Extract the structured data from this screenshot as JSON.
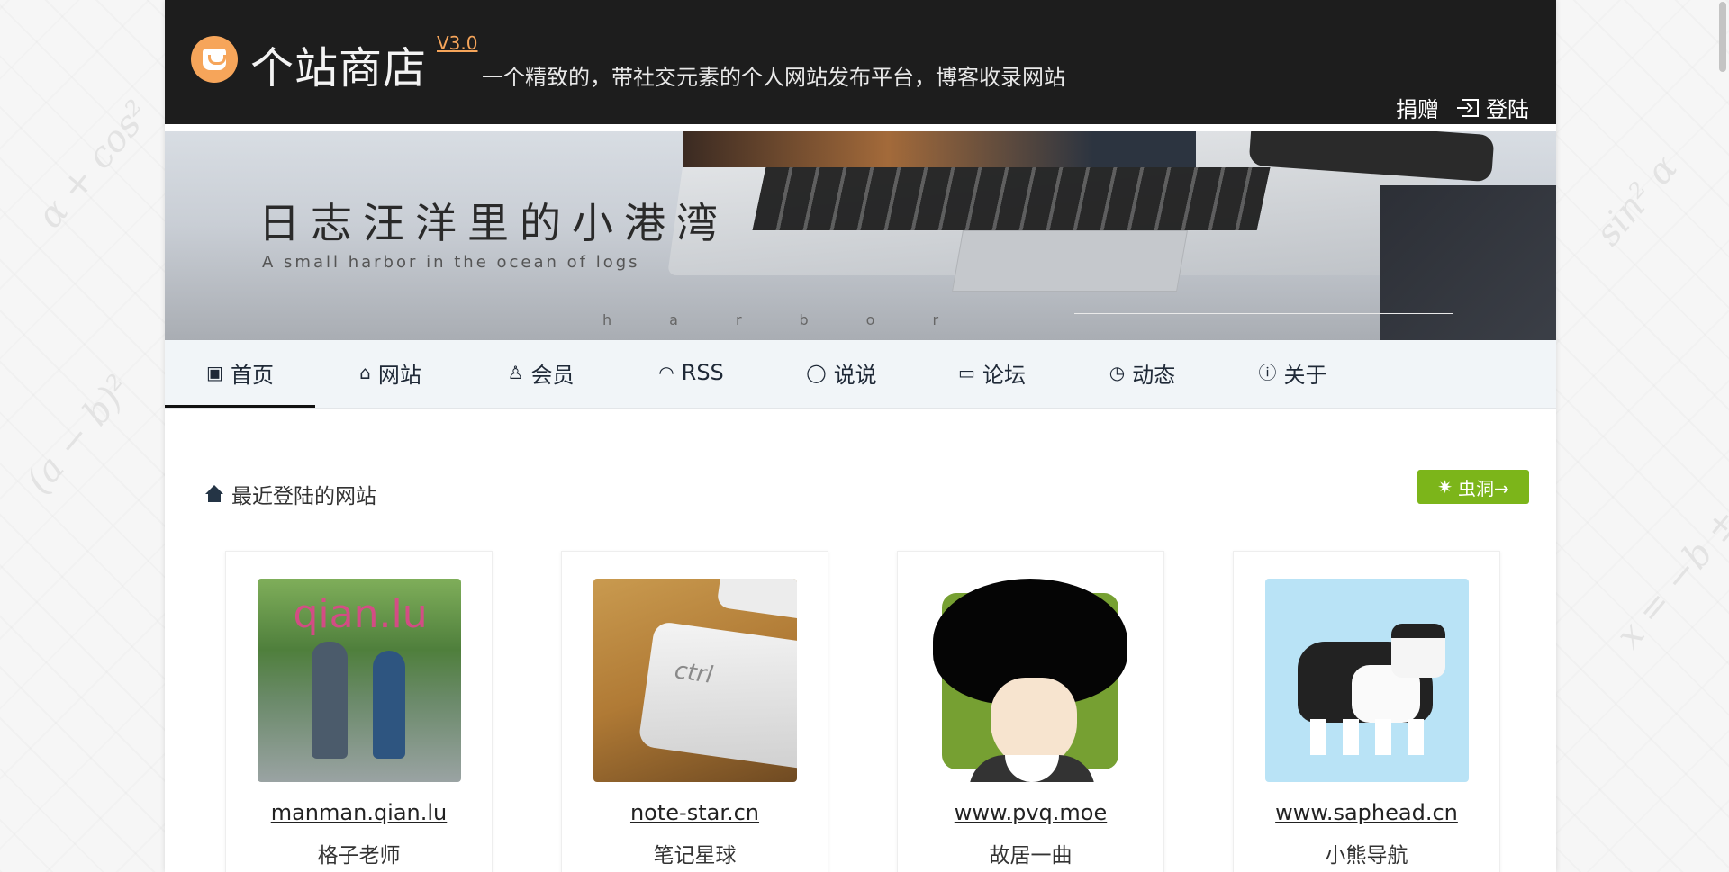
{
  "header": {
    "title": "个站商店",
    "version": "V3.0",
    "tagline": "一个精致的，带社交元素的个人网站发布平台，博客收录网站",
    "donate_label": "捐赠",
    "login_label": "登陆"
  },
  "banner": {
    "title": "日志汪洋里的小港湾",
    "subtitle": "A small harbor in the ocean of logs",
    "letters": "harbor"
  },
  "nav": {
    "items": [
      {
        "label": "首页",
        "icon": "calendar-icon"
      },
      {
        "label": "网站",
        "icon": "home-icon"
      },
      {
        "label": "会员",
        "icon": "user-icon"
      },
      {
        "label": "RSS",
        "icon": "rss-icon"
      },
      {
        "label": "说说",
        "icon": "chat-icon"
      },
      {
        "label": "论坛",
        "icon": "forum-icon"
      },
      {
        "label": "动态",
        "icon": "timer-icon"
      },
      {
        "label": "关于",
        "icon": "info-icon"
      }
    ],
    "active_index": 0
  },
  "section": {
    "title": "最近登陆的网站",
    "wormhole_label": "虫洞→"
  },
  "sites": [
    {
      "url": "manman.qian.lu",
      "name": "格子老师",
      "image_text": "qian.lu"
    },
    {
      "url": "note-star.cn",
      "name": "笔记星球",
      "image_text": "ctrl"
    },
    {
      "url": "www.pvq.moe",
      "name": "故居一曲"
    },
    {
      "url": "www.saphead.cn",
      "name": "小熊导航"
    }
  ],
  "colors": {
    "header_bg": "#1d1d1d",
    "accent": "#f6a55a",
    "wormhole_bg": "#7cb51a",
    "nav_bg": "#f1f5f8"
  }
}
